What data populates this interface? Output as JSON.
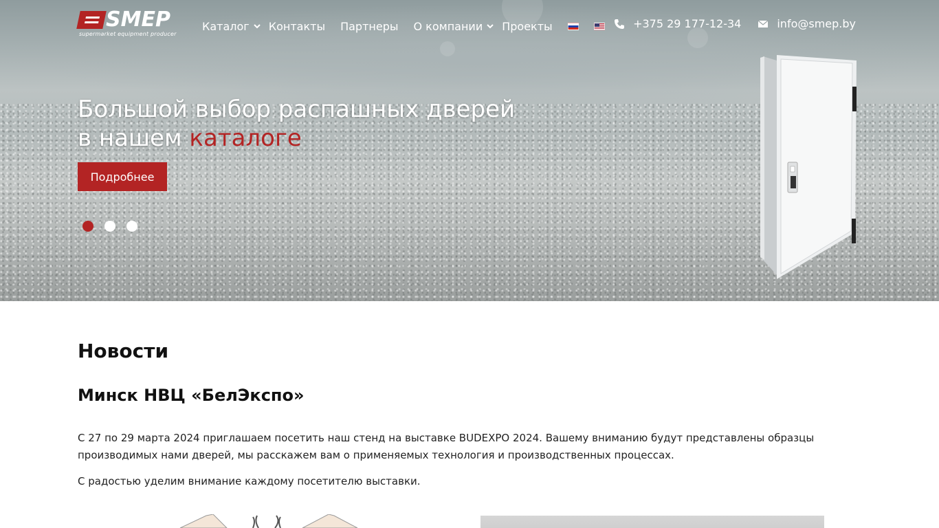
{
  "header": {
    "logo": {
      "name": "SMEP",
      "tagline": "supermarket equipment producer"
    },
    "nav": [
      {
        "label": "Каталог",
        "has_dropdown": true
      },
      {
        "label": "Контакты",
        "has_dropdown": false
      },
      {
        "label": "Партнеры",
        "has_dropdown": false
      },
      {
        "label": "О компании",
        "has_dropdown": true
      },
      {
        "label": "Проекты",
        "has_dropdown": false
      }
    ],
    "languages": [
      "ru",
      "en"
    ],
    "phone": "+375 29 177-12-34",
    "email": "info@smep.by"
  },
  "hero": {
    "title_line1": "Большой выбор распашных дверей",
    "title_line2_prefix": "в нашем ",
    "title_line2_accent": "каталоге",
    "button_label": "Подробнее",
    "slides": 3,
    "active_slide": 1
  },
  "news": {
    "section_title": "Новости",
    "article_title": "Минск НВЦ «БелЭкспо»",
    "paragraph1": "С 27 по 29 марта 2024 приглашаем посетить наш стенд на выставке BUDEXPO 2024. Вашему вниманию будут представлены образцы производимых нами дверей, мы расскажем вам о применяемых технология и производственных процессах.",
    "paragraph2": "С радостью уделим внимание каждому посетителю выставки."
  },
  "colors": {
    "accent": "#b32424",
    "hero_text": "#ffffff",
    "body_text": "#222222"
  },
  "icons": {
    "phone": "phone-icon",
    "email": "envelope-icon",
    "dropdown": "chevron-down-icon"
  }
}
